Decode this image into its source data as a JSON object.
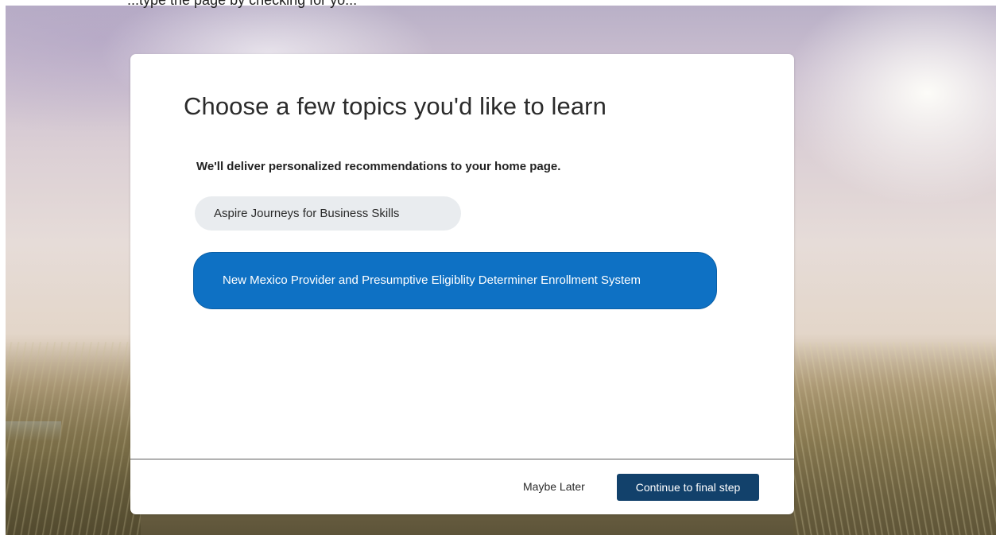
{
  "header": {
    "partial_caption": "...type the page by checking for yo..."
  },
  "dialog": {
    "title": "Choose a few topics you'd like to learn",
    "subtitle": "We'll deliver personalized recommendations to your home page.",
    "topics": [
      {
        "label": "Aspire Journeys for Business Skills",
        "selected": false
      },
      {
        "label": "New Mexico Provider and Presumptive Eligiblity Determiner Enrollment System",
        "selected": true
      }
    ],
    "footer": {
      "maybe_later_label": "Maybe Later",
      "continue_label": "Continue to final step"
    }
  },
  "colors": {
    "selected_chip": "#0e71c4",
    "unselected_chip": "#e9ecef",
    "primary_button": "#12416b"
  }
}
